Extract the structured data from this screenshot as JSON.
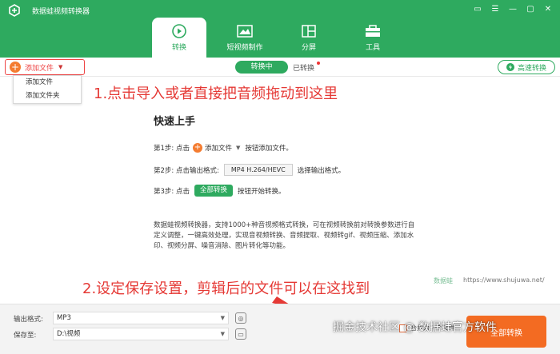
{
  "app": {
    "title": "数据蛙视频转换器"
  },
  "window_controls": [
    "▭",
    "☰",
    "—",
    "▢",
    "✕"
  ],
  "tabs": [
    {
      "label": "转换",
      "icon": "convert-icon",
      "active": true
    },
    {
      "label": "短视频制作",
      "icon": "short-video-icon",
      "active": false
    },
    {
      "label": "分屏",
      "icon": "split-screen-icon",
      "active": false
    },
    {
      "label": "工具",
      "icon": "toolbox-icon",
      "active": false
    }
  ],
  "toolbar": {
    "add_file": "添加文件",
    "converting": "转换中",
    "converted": "已转换",
    "high_speed": "高速转换"
  },
  "dropdown": {
    "items": [
      "添加文件",
      "添加文件夹"
    ]
  },
  "annotations": {
    "top": "1.点击导入或者直接把音频拖动到这里",
    "bottom": "2.设定保存设置，剪辑后的文件可以在这找到"
  },
  "quick_start": {
    "title": "快速上手",
    "step1": {
      "prefix": "第1步: 点击",
      "button": "添加文件",
      "suffix": "按钮添加文件。"
    },
    "step2": {
      "prefix": "第2步: 点击输出格式:",
      "chip": "MP4 H.264/HEVC",
      "suffix": "选择输出格式。"
    },
    "step3": {
      "prefix": "第3步: 点击",
      "chip": "全部转换",
      "suffix": "按钮开始转换。"
    },
    "description": "数据蛙视频转换器，支持1000+种音视频格式转换，可在视频转换前对转换参数进行自定义调整，一键高效处理，实现音视频转换、音频提取、视频转gif、视频压缩、添加水印、视频分屏、噪音消除、图片转化等功能。"
  },
  "brand": {
    "mark": "数据蛙",
    "url": "https://www.shujuwa.net/"
  },
  "bottom": {
    "output_format_label": "输出格式:",
    "output_format_value": "MP3",
    "save_to_label": "保存至:",
    "save_to_value": "D:\\视频",
    "merge_label": "合并为一个文件",
    "convert_all": "全部转换"
  },
  "watermark": "掘金技术社区 @ 数据蛙官方软件",
  "colors": {
    "brand_green": "#2eaa5f",
    "accent_orange": "#f36b22",
    "annotation_red": "#e53935"
  }
}
